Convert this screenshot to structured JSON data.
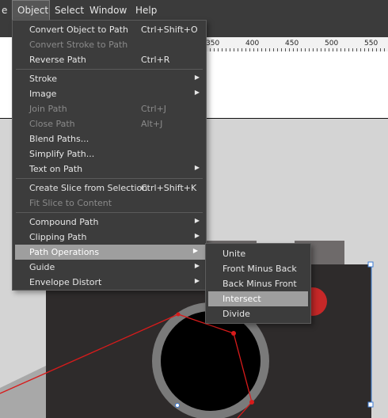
{
  "menubar": {
    "items": [
      {
        "label": "e"
      },
      {
        "label": "Object"
      },
      {
        "label": "Select"
      },
      {
        "label": "Window"
      },
      {
        "label": "Help"
      }
    ]
  },
  "ruler": {
    "labels": [
      "350",
      "400",
      "450",
      "500",
      "550"
    ]
  },
  "object_menu": {
    "items": [
      {
        "label": "Convert Object to Path",
        "shortcut": "Ctrl+Shift+O",
        "enabled": true
      },
      {
        "label": "Convert Stroke to Path",
        "shortcut": "",
        "enabled": false
      },
      {
        "label": "Reverse Path",
        "shortcut": "Ctrl+R",
        "enabled": true
      },
      {
        "label": "Stroke",
        "shortcut": "",
        "enabled": true,
        "submenu": true
      },
      {
        "label": "Image",
        "shortcut": "",
        "enabled": true,
        "submenu": true
      },
      {
        "label": "Join Path",
        "shortcut": "Ctrl+J",
        "enabled": false
      },
      {
        "label": "Close Path",
        "shortcut": "Alt+J",
        "enabled": false
      },
      {
        "label": "Blend Paths...",
        "shortcut": "",
        "enabled": true
      },
      {
        "label": "Simplify Path...",
        "shortcut": "",
        "enabled": true
      },
      {
        "label": "Text on Path",
        "shortcut": "",
        "enabled": true,
        "submenu": true
      },
      {
        "label": "Create Slice from Selection",
        "shortcut": "Ctrl+Shift+K",
        "enabled": true
      },
      {
        "label": "Fit Slice to Content",
        "shortcut": "",
        "enabled": false
      },
      {
        "label": "Compound Path",
        "shortcut": "",
        "enabled": true,
        "submenu": true
      },
      {
        "label": "Clipping Path",
        "shortcut": "",
        "enabled": true,
        "submenu": true
      },
      {
        "label": "Path Operations",
        "shortcut": "",
        "enabled": true,
        "submenu": true,
        "highlighted": true
      },
      {
        "label": "Guide",
        "shortcut": "",
        "enabled": true,
        "submenu": true
      },
      {
        "label": "Envelope Distort",
        "shortcut": "",
        "enabled": true,
        "submenu": true
      }
    ]
  },
  "path_operations_submenu": {
    "items": [
      {
        "label": "Unite"
      },
      {
        "label": "Front Minus Back"
      },
      {
        "label": "Back Minus Front"
      },
      {
        "label": "Intersect",
        "highlighted": true
      },
      {
        "label": "Divide"
      }
    ]
  },
  "colors": {
    "menu_bg": "#3c3c3c",
    "menu_highlight": "#9e9e9e",
    "camera_body": "#2e2b2b",
    "lens_ring": "#7a7a7a",
    "selection_red": "#d81b1b",
    "flash_red": "#c62828"
  }
}
